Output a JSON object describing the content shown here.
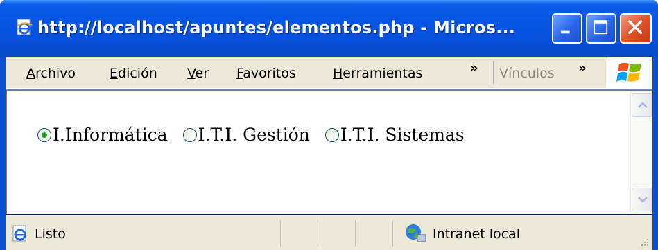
{
  "window": {
    "title": "http://localhost/apuntes/elementos.php - Micros..."
  },
  "icons": {
    "title": "ie-page-icon",
    "minimize": "minimize-icon",
    "maximize": "maximize-icon",
    "close": "close-icon",
    "windows_logo": "windows-logo-icon",
    "status": "ie-page-icon",
    "zone": "intranet-globe-icon"
  },
  "menubar": {
    "archivo": {
      "first": "A",
      "rest": "rchivo"
    },
    "edicion": {
      "first": "E",
      "rest": "dición"
    },
    "ver": {
      "first": "V",
      "rest": "er"
    },
    "favoritos": {
      "first": "F",
      "rest": "avoritos"
    },
    "herramientas": {
      "first": "H",
      "rest": "erramientas"
    },
    "overflow": "»",
    "links": "Vínculos",
    "links_overflow": "»"
  },
  "content": {
    "options": [
      {
        "label": "I.Informática",
        "checked": true
      },
      {
        "label": "I.T.I. Gestión",
        "checked": false
      },
      {
        "label": "I.T.I. Sistemas",
        "checked": false
      }
    ]
  },
  "statusbar": {
    "status": "Listo",
    "zone": "Intranet local"
  },
  "colors": {
    "titlebar": "#0554e3",
    "chrome": "#ece9d8",
    "close_button": "#e0542c",
    "radio_checked": "#21a121"
  }
}
